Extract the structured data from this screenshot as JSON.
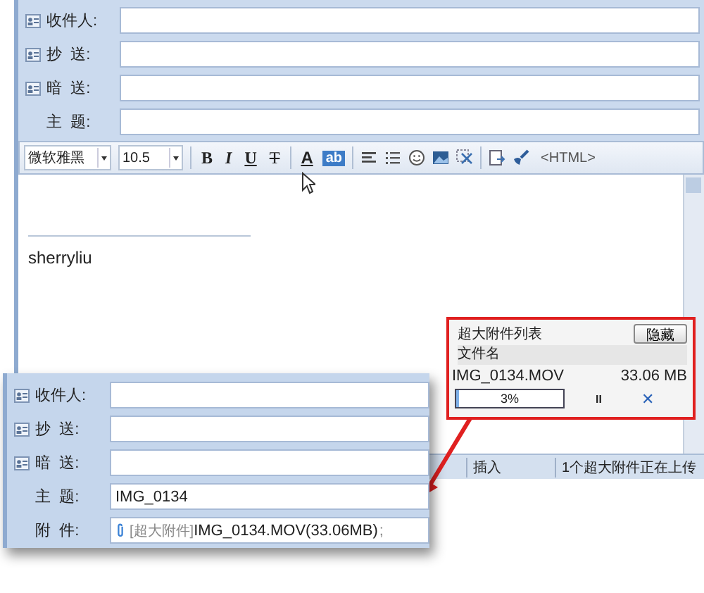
{
  "compose": {
    "fields": [
      {
        "label": "收件人:",
        "kind": "contact"
      },
      {
        "label": "抄  送:",
        "kind": "contact"
      },
      {
        "label": "暗  送:",
        "kind": "contact"
      },
      {
        "label": "主  题:",
        "kind": "plain"
      }
    ]
  },
  "toolbar": {
    "font": "微软雅黑",
    "size": "10.5",
    "format_buttons": [
      "B",
      "I",
      "U",
      "T"
    ],
    "font_color": "A",
    "highlight": "ab",
    "html_label": "<HTML>"
  },
  "editor": {
    "signature": "sherryliu"
  },
  "attachment_panel": {
    "title": "超大附件列表",
    "hide_button": "隐藏",
    "column": "文件名",
    "file": {
      "name": "IMG_0134.MOV",
      "size": "33.06 MB",
      "level": 0.03,
      "percent": "3%",
      "pause": "II",
      "cancel": "✕"
    }
  },
  "status_bar": [
    "插入",
    "1个超大附件正在上传"
  ],
  "zoom_inset": {
    "fields": [
      {
        "label": "收件人:",
        "kind": "contact"
      },
      {
        "label": "抄  送:",
        "kind": "contact"
      },
      {
        "label": "暗  送:",
        "kind": "contact"
      },
      {
        "label": "主  题:",
        "kind": "plain",
        "value": "IMG_0134"
      },
      {
        "label": "附  件:",
        "kind": "attachment",
        "tag": "[超大附件]",
        "value": "IMG_0134.MOV(33.06MB)",
        "separator": ";"
      }
    ]
  }
}
